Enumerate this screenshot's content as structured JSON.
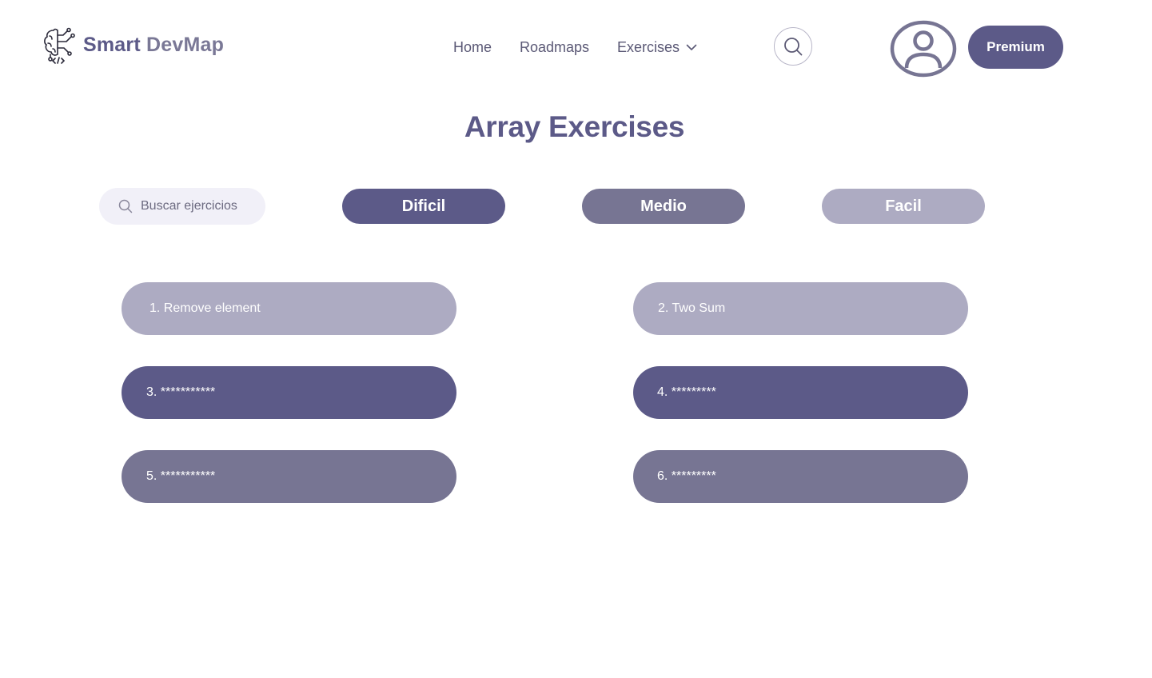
{
  "header": {
    "brand_part1": "Smart",
    "brand_part2": "DevMap",
    "nav": {
      "home": "Home",
      "roadmaps": "Roadmaps",
      "exercises": "Exercises"
    },
    "premium_label": "Premium",
    "icons": [
      "brain-circuit-logo-icon",
      "chevron-down-icon",
      "search-icon",
      "user-avatar-icon"
    ]
  },
  "page": {
    "title": "Array Exercises"
  },
  "filters": {
    "search_placeholder": "Buscar ejercicios",
    "difficulty": [
      "Dificil",
      "Medio",
      "Facil"
    ]
  },
  "exercises": [
    {
      "label": "1. Remove element"
    },
    {
      "label": "2. Two Sum"
    },
    {
      "label": "3. ***********"
    },
    {
      "label": "4. *********"
    },
    {
      "label": "5. ***********"
    },
    {
      "label": "6. *********"
    }
  ],
  "colors": {
    "primary": "#5c5a88",
    "medium": "#777593",
    "light": "#adabc2",
    "search_bg": "#f1f0f8"
  }
}
